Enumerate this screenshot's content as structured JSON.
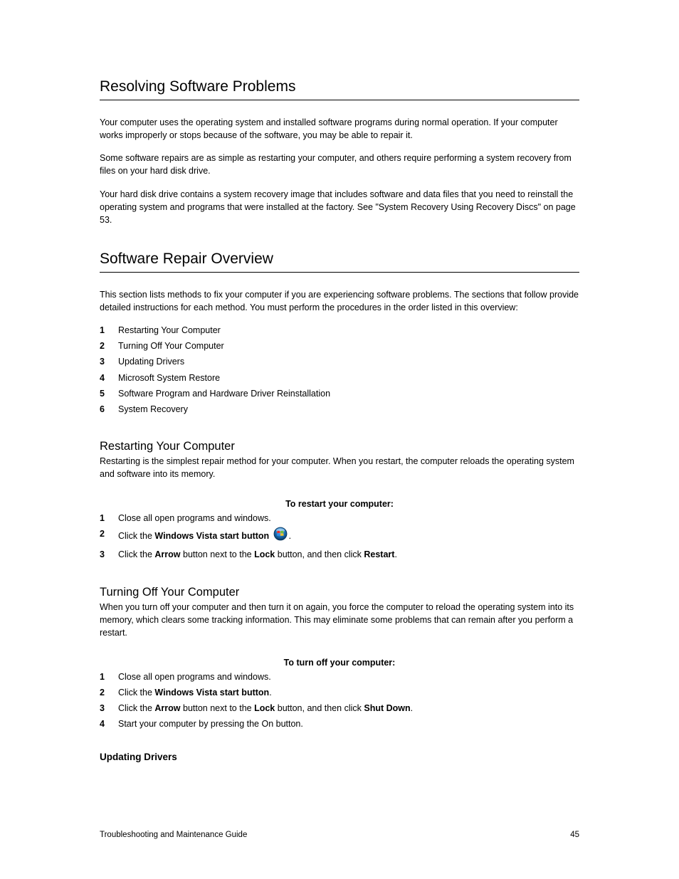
{
  "section1": {
    "title": "Resolving Software Problems",
    "p1_a": "Your computer uses the operating system and installed software programs during normal operation. If your computer works improperly or stops because of the software, you may be able to repair it.",
    "p1_b_a": "Some software repairs are as simple as restarting your computer, and others require performing a system recovery from files on your hard disk drive.",
    "p1_c_a": "Your hard disk drive contains a system recovery image that includes software and data files that you need to reinstall the operating system and programs that were installed at the factory. See ",
    "p1_c_link": "\"System Recovery Using Recovery Discs\" on page 53",
    "p1_c_b": "."
  },
  "section2": {
    "title": "Software Repair Overview",
    "intro_a": "This section lists methods to fix your computer if you are experiencing software problems. The sections that follow provide detailed instructions for each method. You must perform the procedures in the order listed in this overview:",
    "steps": [
      "Restarting Your Computer",
      "Turning Off Your Computer",
      "Updating Drivers",
      "Microsoft System Restore",
      "Software Program and Hardware Driver Reinstallation",
      "System Recovery"
    ]
  },
  "restart": {
    "title": "Restarting Your Computer",
    "intro": "Restarting is the simplest repair method for your computer. When you restart, the computer reloads the operating system and software into its memory.",
    "procedure_title": "To restart your computer:",
    "steps": [
      {
        "num": "1",
        "text": "Close all open programs and windows."
      },
      {
        "num": "2",
        "pre": "Click the ",
        "bold1": "Windows Vista start button",
        "post_icon": "."
      },
      {
        "num": "3",
        "pre": "Click the ",
        "bold1": "Arrow",
        "mid": " button next to the ",
        "bold2": "Lock",
        "post": " button, and then click ",
        "bold3": "Restart",
        "end": "."
      }
    ]
  },
  "turnoff": {
    "title": "Turning Off Your Computer",
    "intro": "When you turn off your computer and then turn it on again, you force the computer to reload the operating system into its memory, which clears some tracking information. This may eliminate some problems that can remain after you perform a restart.",
    "procedure_title": "To turn off your computer:",
    "steps": [
      {
        "num": "1",
        "text": "Close all open programs and windows."
      },
      {
        "num": "2",
        "pre": "Click the ",
        "bold1": "Windows Vista start button",
        "post": "."
      },
      {
        "num": "3",
        "pre": "Click the ",
        "bold1": "Arrow",
        "mid": " button next to the ",
        "bold2": "Lock",
        "post": " button, and then click ",
        "bold3": "Shut Down",
        "end": "."
      },
      {
        "num": "4",
        "text": "Start your computer by pressing the On button."
      }
    ]
  },
  "footer": {
    "left": "Troubleshooting and Maintenance Guide",
    "right": "45"
  }
}
